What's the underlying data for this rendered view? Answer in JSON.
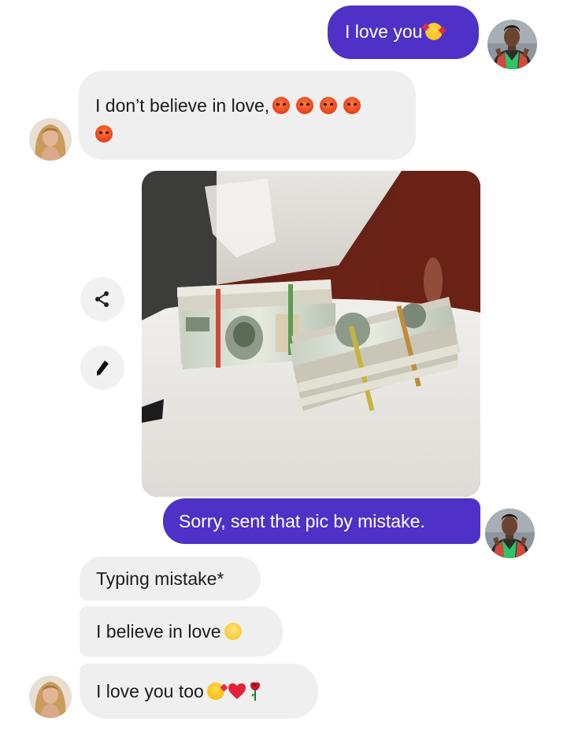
{
  "messages": {
    "m1": {
      "text": "I love you",
      "emoji": "smiling-face-with-hearts"
    },
    "m2": {
      "text": "I don’t believe in love,",
      "emoji": [
        "angry-face",
        "angry-face",
        "angry-face",
        "angry-face",
        "angry-face"
      ]
    },
    "m3": {
      "image": "stacks-of-dollar-bills-on-table"
    },
    "m4": {
      "text": "Sorry, sent that pic by mistake."
    },
    "m5": {
      "text": "Typing mistake*"
    },
    "m6": {
      "text": "I believe in love",
      "emoji": "teary-smiling-face"
    },
    "m7": {
      "text": "I love you too",
      "emoji": [
        "face-blowing-kiss",
        "red-heart",
        "rose"
      ]
    }
  },
  "actions": {
    "share_icon": "share-icon",
    "edit_icon": "pencil-icon"
  },
  "colors": {
    "outgoing_bubble": "#4f31c8",
    "incoming_bubble": "#efefef",
    "outgoing_text": "#ffffff",
    "incoming_text": "#1c1c1c"
  }
}
